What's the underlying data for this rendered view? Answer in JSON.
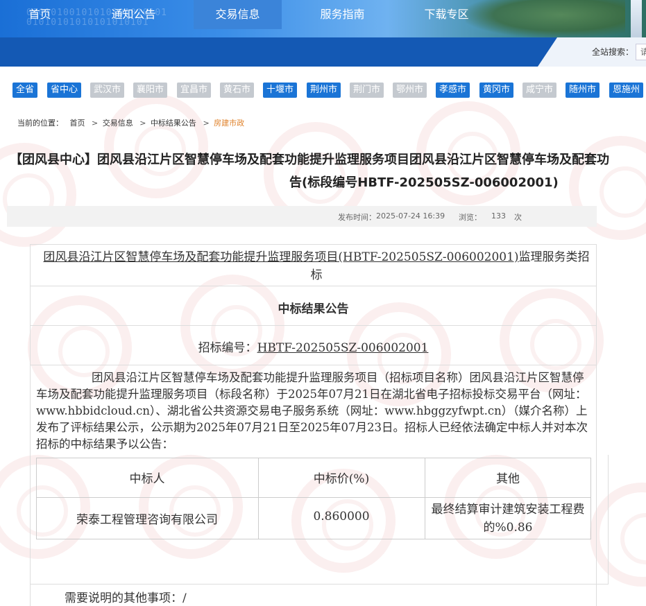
{
  "banner": {
    "digits": "01010100101010101010101\n01010101010101010101"
  },
  "nav": {
    "items": [
      {
        "label": "首页"
      },
      {
        "label": "通知公告"
      },
      {
        "label": "交易信息"
      },
      {
        "label": "服务指南"
      },
      {
        "label": "下载专区"
      }
    ],
    "active_index": 2,
    "search_label": "全站搜索：",
    "search_placeholder": "请"
  },
  "cities": [
    {
      "label": "全省",
      "enabled": true
    },
    {
      "label": "省中心",
      "enabled": true
    },
    {
      "label": "武汉市",
      "enabled": false
    },
    {
      "label": "襄阳市",
      "enabled": false
    },
    {
      "label": "宜昌市",
      "enabled": false
    },
    {
      "label": "黄石市",
      "enabled": false
    },
    {
      "label": "十堰市",
      "enabled": true
    },
    {
      "label": "荆州市",
      "enabled": true
    },
    {
      "label": "荆门市",
      "enabled": false
    },
    {
      "label": "鄂州市",
      "enabled": false
    },
    {
      "label": "孝感市",
      "enabled": true
    },
    {
      "label": "黄冈市",
      "enabled": true
    },
    {
      "label": "咸宁市",
      "enabled": false
    },
    {
      "label": "随州市",
      "enabled": true
    },
    {
      "label": "恩施州",
      "enabled": true
    }
  ],
  "colors": {
    "nav_bg": "#1459b4",
    "nav_active": "#3b84d9",
    "city_on": "#1a74d6",
    "city_off": "#c4c9cf",
    "crumb_current": "#e0822b"
  },
  "breadcrumb": {
    "prefix": "当前的位置：",
    "items": [
      "首页",
      "交易信息",
      "中标结果公告"
    ],
    "current": "房建市政"
  },
  "article": {
    "title_line1": "【团风县中心】团风县沿江片区智慧停车场及配套功能提升监理服务项目团风县沿江片区智慧停车场及配套功",
    "title_line2": "告(标段编号HBTF-202505SZ-006002001)",
    "publish_label": "发布时间：",
    "publish_time": "2025-07-24 16:39",
    "views_label": "浏览：",
    "views": "133",
    "views_unit": "次"
  },
  "doc": {
    "project_underlined": "团风县沿江片区智慧停车场及配套功能提升监理服务项目(HBTF-202505SZ-006002001)",
    "project_suffix": "监理服务类招标",
    "notice_heading": "中标结果公告",
    "bid_no_label": "招标编号：",
    "bid_no": "HBTF-202505SZ-006002001",
    "paragraph": "团风县沿江片区智慧停车场及配套功能提升监理服务项目（招标项目名称）团风县沿江片区智慧停车场及配套功能提升监理服务项目（标段名称）于2025年07月21日在湖北省电子招标投标交易平台（网址：www.hbbidcloud.cn）、湖北省公共资源交易电子服务系统（网址：www.hbggzyfwpt.cn）（媒介名称）上发布了评标结果公示，公示期为2025年07月21日至2025年07月23日。招标人已经依法确定中标人并对本次招标的中标结果予以公告：",
    "table": {
      "headers": [
        "中标人",
        "中标价(%)",
        "其他"
      ],
      "row": [
        "荣泰工程管理咨询有限公司",
        "0.860000",
        "最终结算审计建筑安装工程费的%0.86"
      ]
    },
    "other_note": "需要说明的其他事项：/"
  }
}
